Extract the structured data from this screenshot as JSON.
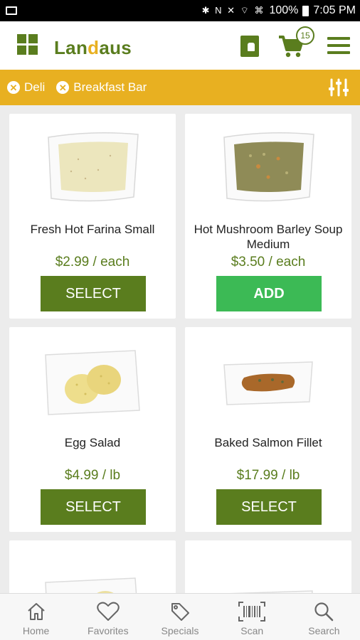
{
  "status_bar": {
    "battery": "100%",
    "time": "7:05 PM"
  },
  "header": {
    "logo_text_a": "Lan",
    "logo_text_accent": "d",
    "logo_text_b": "aus",
    "cart_count": "15"
  },
  "filters": [
    {
      "label": "Deli"
    },
    {
      "label": "Breakfast Bar"
    }
  ],
  "products": [
    {
      "name": "Fresh Hot Farina Small",
      "price": "$2.99 / each",
      "button": "SELECT"
    },
    {
      "name": "Hot Mushroom Barley Soup Medium",
      "price": "$3.50 / each",
      "button": "ADD"
    },
    {
      "name": "Egg Salad",
      "price": "$4.99 / lb",
      "button": "SELECT"
    },
    {
      "name": "Baked Salmon Fillet",
      "price": "$17.99 / lb",
      "button": "SELECT"
    }
  ],
  "bottom_nav": [
    {
      "label": "Home",
      "icon": "home-icon"
    },
    {
      "label": "Favorites",
      "icon": "heart-icon"
    },
    {
      "label": "Specials",
      "icon": "tag-icon"
    },
    {
      "label": "Scan",
      "icon": "barcode-icon"
    },
    {
      "label": "Search",
      "icon": "search-icon"
    }
  ],
  "colors": {
    "brand_green": "#5a7d1e",
    "accent_yellow": "#e8b021",
    "add_green": "#3cba55"
  }
}
